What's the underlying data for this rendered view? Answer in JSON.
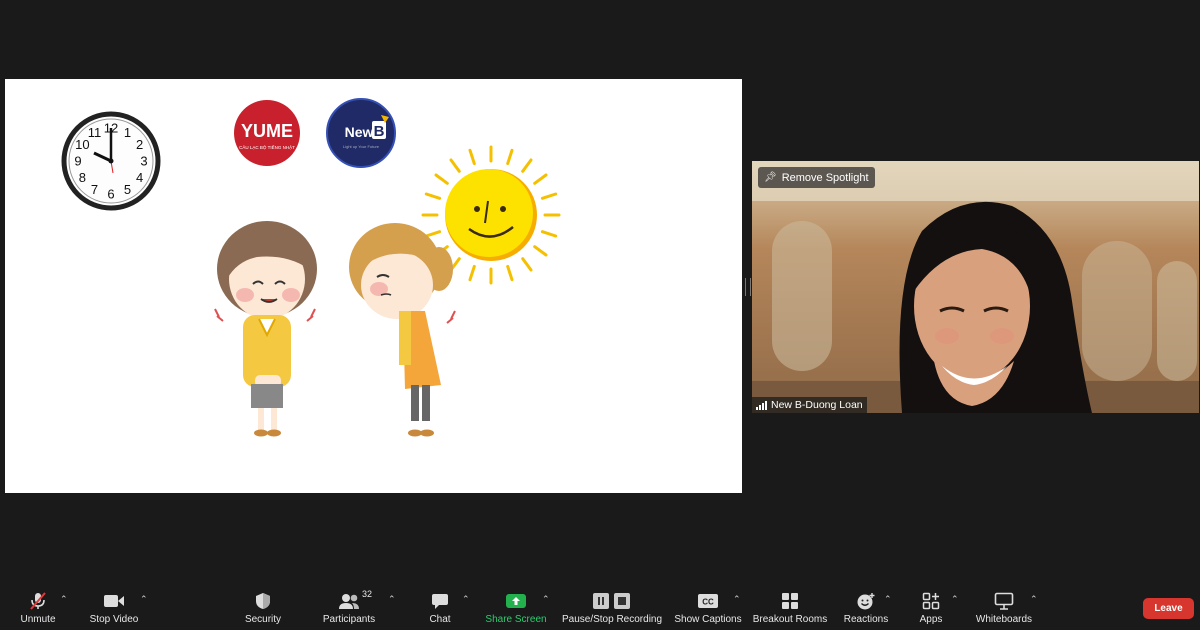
{
  "shared_screen": {
    "logos": [
      {
        "text": "YUME",
        "subtext": "CÂU LẠC BỘ TIẾNG NHẬT",
        "color": "#c8202c"
      },
      {
        "text": "New",
        "badge": "B",
        "subtext": "Light up Your Future",
        "color": "#1f2a66"
      }
    ],
    "clock_numbers": [
      "12",
      "1",
      "2",
      "3",
      "4",
      "5",
      "6",
      "7",
      "8",
      "9",
      "10",
      "11"
    ]
  },
  "video": {
    "remove_spotlight_label": "Remove Spotlight",
    "participant_name": "New B-Duong Loan"
  },
  "toolbar": {
    "unmute_label": "Unmute",
    "stop_video_label": "Stop Video",
    "security_label": "Security",
    "participants_label": "Participants",
    "participants_count": "32",
    "chat_label": "Chat",
    "share_screen_label": "Share Screen",
    "recording_label": "Pause/Stop Recording",
    "captions_label": "Show Captions",
    "captions_icon_text": "CC",
    "breakout_label": "Breakout Rooms",
    "reactions_label": "Reactions",
    "apps_label": "Apps",
    "whiteboards_label": "Whiteboards",
    "leave_label": "Leave"
  },
  "colors": {
    "background": "#1a1a1a",
    "share_green": "#23b14d",
    "leave_red": "#d6362d"
  }
}
